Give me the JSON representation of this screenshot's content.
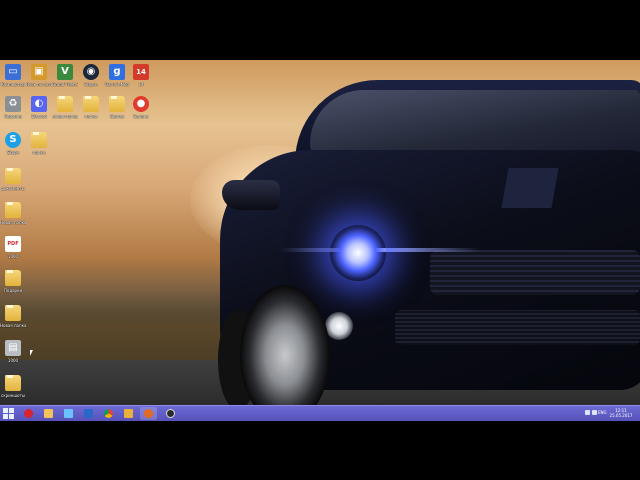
{
  "desktop": {
    "icons": [
      {
        "id": "computer",
        "label": "Компьютер",
        "glyph": "▭",
        "color": "#3b6fd6"
      },
      {
        "id": "app1",
        "label": "Пуск по сети",
        "glyph": "▣",
        "color": "#d39a2b"
      },
      {
        "id": "gta",
        "label": "Grand Theft Auto",
        "glyph": "V",
        "color": "#3a8a3e"
      },
      {
        "id": "steam",
        "label": "Steam",
        "glyph": "◉",
        "color": "#1b2838"
      },
      {
        "id": "garrysmod",
        "label": "Garry's Mod",
        "glyph": "g",
        "color": "#2f6fe0"
      },
      {
        "id": "app14",
        "label": "14",
        "glyph": "14",
        "color": "#d33a2a"
      },
      {
        "id": "recycle",
        "label": "Корзина",
        "glyph": "♻",
        "color": "#8a8f96"
      },
      {
        "id": "discord",
        "label": "Discord",
        "glyph": "◐",
        "color": "#5865f2"
      },
      {
        "id": "folder-a",
        "label": "новая папка",
        "glyph": "",
        "color": ""
      },
      {
        "id": "folder-b",
        "label": "папка",
        "glyph": "",
        "color": ""
      },
      {
        "id": "folder-c",
        "label": "Games",
        "glyph": "",
        "color": ""
      },
      {
        "id": "app-ball",
        "label": "Баланс",
        "glyph": "●",
        "color": "#e23a2c"
      },
      {
        "id": "skype",
        "label": "Skype",
        "glyph": "S",
        "color": "#1fa0e6"
      },
      {
        "id": "folder-d",
        "label": "папка",
        "glyph": "",
        "color": ""
      },
      {
        "id": "folder-e",
        "label": "документы",
        "glyph": "",
        "color": ""
      },
      {
        "id": "folder-f",
        "label": "Новая папка",
        "glyph": "",
        "color": ""
      },
      {
        "id": "pdf",
        "label": "1000",
        "glyph": "PDF",
        "color": "#d12b2b"
      },
      {
        "id": "folder-g",
        "label": "Подарки",
        "glyph": "",
        "color": ""
      },
      {
        "id": "folder-h",
        "label": "Новая папка",
        "glyph": "",
        "color": ""
      },
      {
        "id": "file-1000",
        "label": "1000",
        "glyph": "▤",
        "color": "#b9bcc2"
      },
      {
        "id": "folder-i",
        "label": "скриншоты",
        "glyph": "",
        "color": ""
      }
    ]
  },
  "taskbar": {
    "apps": [
      {
        "id": "opera",
        "glyph": "color",
        "color": "#d9232e"
      },
      {
        "id": "explorer",
        "glyph": "color",
        "color": "#f2c35b"
      },
      {
        "id": "media",
        "glyph": "color",
        "color": "#6cc1ff"
      },
      {
        "id": "mail",
        "glyph": "color",
        "color": "#2b66c9"
      },
      {
        "id": "chrome",
        "glyph": "color",
        "color": "#3aa757"
      },
      {
        "id": "paint",
        "glyph": "color",
        "color": "#e8b13a"
      },
      {
        "id": "firefox",
        "glyph": "color",
        "color": "#e46a1f"
      },
      {
        "id": "obs",
        "glyph": "color",
        "color": "#2b2b2b"
      }
    ],
    "language": "ENG",
    "time": "12:11",
    "date": "25.05.2017"
  }
}
